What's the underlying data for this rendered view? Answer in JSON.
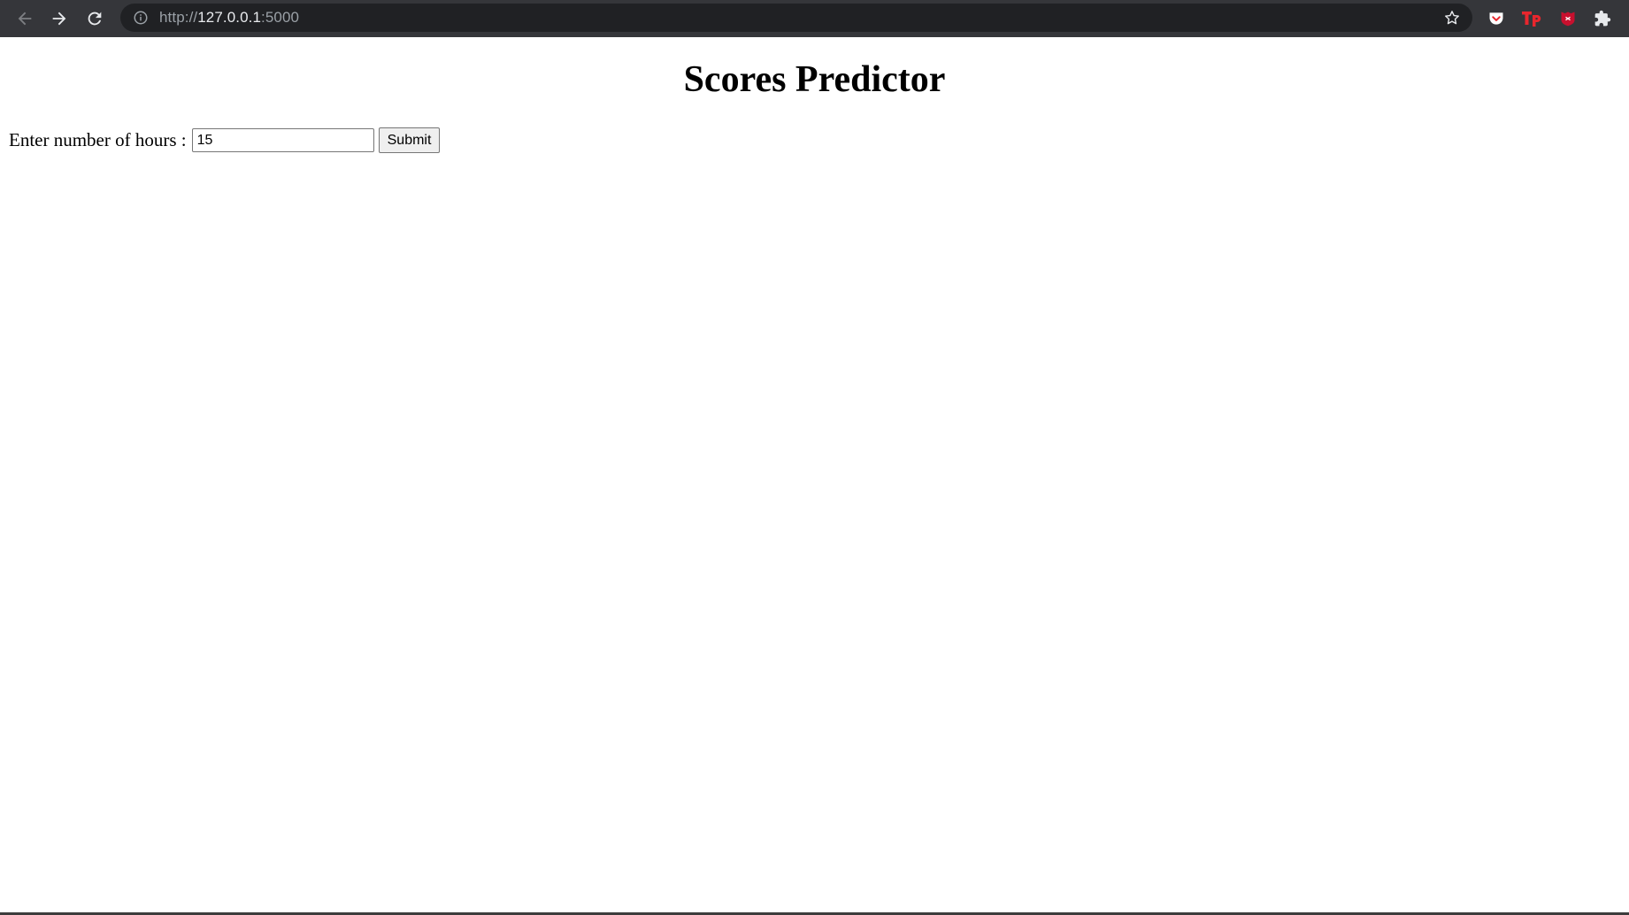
{
  "browser": {
    "url_scheme": "http://",
    "url_host": "127.0.0.1",
    "url_port": ":5000",
    "icons": {
      "back": "back-arrow-icon",
      "forward": "forward-arrow-icon",
      "reload": "reload-icon",
      "site_info": "info-icon",
      "bookmark": "star-icon",
      "extension_1": "pocket-icon",
      "extension_2": "tp-icon",
      "extension_3": "shield-icon",
      "extensions_menu": "puzzle-icon"
    },
    "colors": {
      "toolbar": "#35363a",
      "omnibox": "#202124",
      "extension_red": "#e8262d"
    }
  },
  "page": {
    "title": "Scores Predictor",
    "form": {
      "label": "Enter number of hours :",
      "hours_value": "15",
      "submit_label": "Submit"
    }
  }
}
